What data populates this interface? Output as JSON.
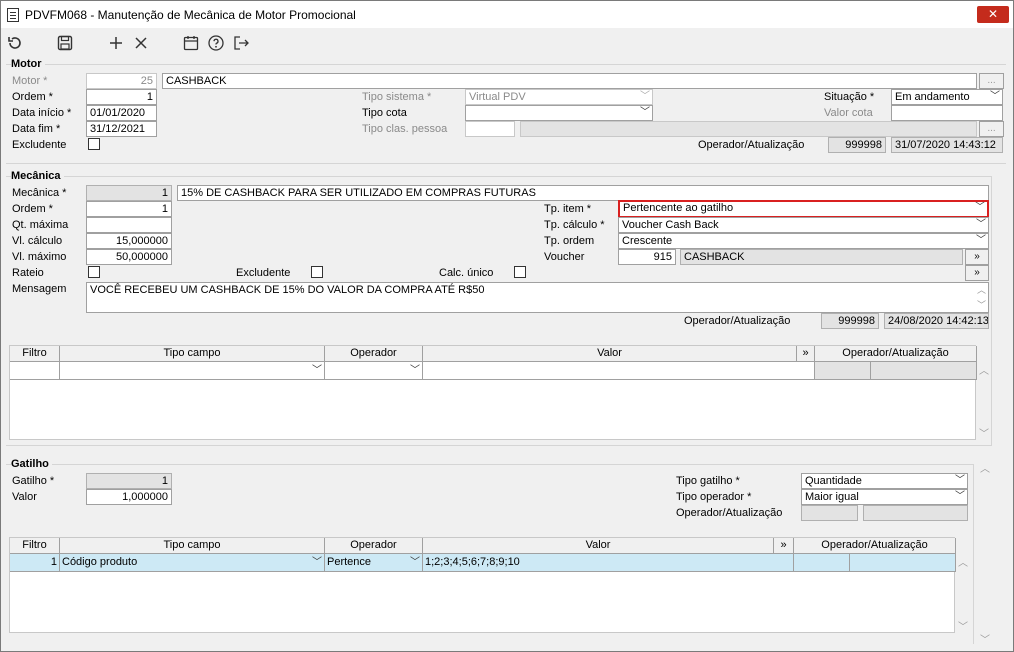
{
  "window": {
    "title": "PDVFM068 - Manutenção de Mecânica de Motor Promocional",
    "close_label": "✕"
  },
  "toolbar": {
    "icons": [
      "refresh-icon",
      "save-icon",
      "add-icon",
      "delete-icon",
      "calendar-icon",
      "help-icon",
      "exit-icon"
    ]
  },
  "motor": {
    "section_title": "Motor",
    "motor_label": "Motor *",
    "motor_code": "25",
    "motor_desc": "CASHBACK",
    "ordem_label": "Ordem *",
    "ordem_value": "1",
    "data_inicio_label": "Data início *",
    "data_inicio_value": "01/01/2020",
    "data_fim_label": "Data fim *",
    "data_fim_value": "31/12/2021",
    "excludente_label": "Excludente",
    "tipo_sistema_label": "Tipo sistema *",
    "tipo_sistema_value": "Virtual PDV",
    "tipo_cota_label": "Tipo cota",
    "tipo_cota_value": "",
    "tipo_clas_label": "Tipo clas. pessoa",
    "tipo_clas_value": "",
    "situacao_label": "Situação *",
    "situacao_value": "Em andamento",
    "valor_cota_label": "Valor cota",
    "valor_cota_value": "",
    "operador_label": "Operador/Atualização",
    "operador_value": "999998",
    "atualizacao_value": "31/07/2020 14:43:12",
    "more_label": "..."
  },
  "mecanica": {
    "section_title": "Mecânica",
    "mecanica_label": "Mecânica *",
    "mecanica_code": "1",
    "mecanica_desc": "15% DE CASHBACK PARA SER UTILIZADO EM COMPRAS FUTURAS",
    "ordem_label": "Ordem *",
    "ordem_value": "1",
    "qt_maxima_label": "Qt. máxima",
    "qt_maxima_value": "",
    "vl_calculo_label": "Vl. cálculo",
    "vl_calculo_value": "15,000000",
    "vl_maximo_label": "Vl. máximo",
    "vl_maximo_value": "50,000000",
    "rateio_label": "Rateio",
    "excludente_label": "Excludente",
    "calc_unico_label": "Calc. único",
    "mensagem_label": "Mensagem",
    "mensagem_value": "VOCÊ RECEBEU UM CASHBACK DE 15% DO VALOR DA COMPRA ATÉ R$50",
    "tp_item_label": "Tp. item *",
    "tp_item_value": "Pertencente ao gatilho",
    "tp_calculo_label": "Tp. cálculo *",
    "tp_calculo_value": "Voucher Cash Back",
    "tp_ordem_label": "Tp. ordem",
    "tp_ordem_value": "Crescente",
    "voucher_label": "Voucher",
    "voucher_code": "915",
    "voucher_desc": "CASHBACK",
    "operador_label": "Operador/Atualização",
    "operador_value": "999998",
    "atualizacao_value": "24/08/2020 14:42:13",
    "more_label": "»"
  },
  "filtro_grid_1": {
    "headers": [
      "Filtro",
      "Tipo campo",
      "Operador",
      "Valor",
      "»",
      "Operador/Atualização"
    ],
    "row": [
      "",
      "",
      "",
      "",
      "",
      ""
    ]
  },
  "gatilho": {
    "section_title": "Gatilho",
    "gatilho_label": "Gatilho *",
    "gatilho_value": "1",
    "valor_label": "Valor",
    "valor_value": "1,000000",
    "tipo_gatilho_label": "Tipo gatilho *",
    "tipo_gatilho_value": "Quantidade",
    "tipo_operador_label": "Tipo operador *",
    "tipo_operador_value": "Maior igual",
    "operador_label": "Operador/Atualização",
    "operador_value": "",
    "atualizacao_value": ""
  },
  "filtro_grid_2": {
    "headers": [
      "Filtro",
      "Tipo campo",
      "Operador",
      "Valor",
      "»",
      "Operador/Atualização"
    ],
    "row": {
      "filtro": "1",
      "tipo_campo": "Código produto",
      "operador": "Pertence",
      "valor": "1;2;3;4;5;6;7;8;9;10",
      "op_atual_1": "",
      "op_atual_2": ""
    }
  },
  "colors": {
    "selected_row": "#cde9f5",
    "close_button": "#c42b1c",
    "required_highlight": "#d92020"
  }
}
